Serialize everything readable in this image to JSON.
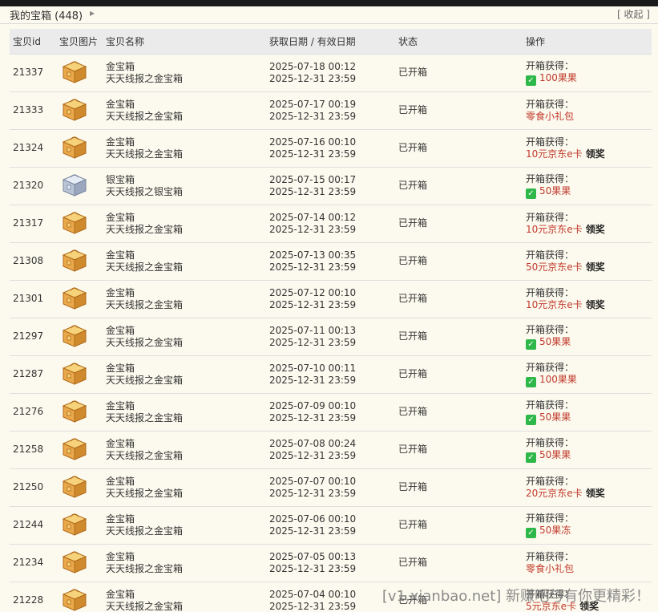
{
  "header": {
    "title": "我的宝箱 (448)",
    "collapse_label": "[ 收起 ]"
  },
  "table": {
    "columns": [
      "宝贝id",
      "宝贝图片",
      "宝贝名称",
      "获取日期 / 有效日期",
      "状态",
      "操作"
    ],
    "rows": [
      {
        "id": "21337",
        "icon": "gold-chest-icon",
        "type": "金宝箱",
        "desc": "天天线报之金宝箱",
        "obtained": "2025-07-18 00:12",
        "expires": "2025-12-31 23:59",
        "status": "已开箱",
        "prize_label": "开箱获得：",
        "check": true,
        "prize": "100果果",
        "claim": ""
      },
      {
        "id": "21333",
        "icon": "gold-chest-icon",
        "type": "金宝箱",
        "desc": "天天线报之金宝箱",
        "obtained": "2025-07-17 00:19",
        "expires": "2025-12-31 23:59",
        "status": "已开箱",
        "prize_label": "开箱获得：",
        "check": false,
        "prize": "零食小礼包",
        "claim": ""
      },
      {
        "id": "21324",
        "icon": "gold-chest-icon",
        "type": "金宝箱",
        "desc": "天天线报之金宝箱",
        "obtained": "2025-07-16 00:10",
        "expires": "2025-12-31 23:59",
        "status": "已开箱",
        "prize_label": "开箱获得：",
        "check": false,
        "prize": "10元京东e卡",
        "claim": "领奖"
      },
      {
        "id": "21320",
        "icon": "silver-chest-icon",
        "type": "银宝箱",
        "desc": "天天线报之银宝箱",
        "obtained": "2025-07-15 00:17",
        "expires": "2025-12-31 23:59",
        "status": "已开箱",
        "prize_label": "开箱获得：",
        "check": true,
        "prize": "50果果",
        "claim": ""
      },
      {
        "id": "21317",
        "icon": "gold-chest-icon",
        "type": "金宝箱",
        "desc": "天天线报之金宝箱",
        "obtained": "2025-07-14 00:12",
        "expires": "2025-12-31 23:59",
        "status": "已开箱",
        "prize_label": "开箱获得：",
        "check": false,
        "prize": "10元京东e卡",
        "claim": "领奖"
      },
      {
        "id": "21308",
        "icon": "gold-chest-icon",
        "type": "金宝箱",
        "desc": "天天线报之金宝箱",
        "obtained": "2025-07-13 00:35",
        "expires": "2025-12-31 23:59",
        "status": "已开箱",
        "prize_label": "开箱获得：",
        "check": false,
        "prize": "50元京东e卡",
        "claim": "领奖"
      },
      {
        "id": "21301",
        "icon": "gold-chest-icon",
        "type": "金宝箱",
        "desc": "天天线报之金宝箱",
        "obtained": "2025-07-12 00:10",
        "expires": "2025-12-31 23:59",
        "status": "已开箱",
        "prize_label": "开箱获得：",
        "check": false,
        "prize": "10元京东e卡",
        "claim": "领奖"
      },
      {
        "id": "21297",
        "icon": "gold-chest-icon",
        "type": "金宝箱",
        "desc": "天天线报之金宝箱",
        "obtained": "2025-07-11 00:13",
        "expires": "2025-12-31 23:59",
        "status": "已开箱",
        "prize_label": "开箱获得：",
        "check": true,
        "prize": "50果果",
        "claim": ""
      },
      {
        "id": "21287",
        "icon": "gold-chest-icon",
        "type": "金宝箱",
        "desc": "天天线报之金宝箱",
        "obtained": "2025-07-10 00:11",
        "expires": "2025-12-31 23:59",
        "status": "已开箱",
        "prize_label": "开箱获得：",
        "check": true,
        "prize": "100果果",
        "claim": ""
      },
      {
        "id": "21276",
        "icon": "gold-chest-icon",
        "type": "金宝箱",
        "desc": "天天线报之金宝箱",
        "obtained": "2025-07-09 00:10",
        "expires": "2025-12-31 23:59",
        "status": "已开箱",
        "prize_label": "开箱获得：",
        "check": true,
        "prize": "50果果",
        "claim": ""
      },
      {
        "id": "21258",
        "icon": "gold-chest-icon",
        "type": "金宝箱",
        "desc": "天天线报之金宝箱",
        "obtained": "2025-07-08 00:24",
        "expires": "2025-12-31 23:59",
        "status": "已开箱",
        "prize_label": "开箱获得：",
        "check": true,
        "prize": "50果果",
        "claim": ""
      },
      {
        "id": "21250",
        "icon": "gold-chest-icon",
        "type": "金宝箱",
        "desc": "天天线报之金宝箱",
        "obtained": "2025-07-07 00:10",
        "expires": "2025-12-31 23:59",
        "status": "已开箱",
        "prize_label": "开箱获得：",
        "check": false,
        "prize": "20元京东e卡",
        "claim": "领奖"
      },
      {
        "id": "21244",
        "icon": "gold-chest-icon",
        "type": "金宝箱",
        "desc": "天天线报之金宝箱",
        "obtained": "2025-07-06 00:10",
        "expires": "2025-12-31 23:59",
        "status": "已开箱",
        "prize_label": "开箱获得：",
        "check": true,
        "prize": "50果冻",
        "claim": ""
      },
      {
        "id": "21234",
        "icon": "gold-chest-icon",
        "type": "金宝箱",
        "desc": "天天线报之金宝箱",
        "obtained": "2025-07-05 00:13",
        "expires": "2025-12-31 23:59",
        "status": "已开箱",
        "prize_label": "开箱获得：",
        "check": false,
        "prize": "零食小礼包",
        "claim": ""
      },
      {
        "id": "21228",
        "icon": "gold-chest-icon",
        "type": "金宝箱",
        "desc": "天天线报之金宝箱",
        "obtained": "2025-07-04 00:10",
        "expires": "2025-12-31 23:59",
        "status": "已开箱",
        "prize_label": "开箱获得：",
        "check": false,
        "prize": "5元京东e卡",
        "claim": "领奖"
      }
    ]
  },
  "watermark": "[v1.xianbao.net] 新赚吧与有你更精彩！",
  "colors": {
    "background": "#fcfaee",
    "header_row": "#ebebeb",
    "prize": "#c0392b",
    "check": "#2eb84a",
    "gold": "#f0c060",
    "silver": "#c8d0e0"
  }
}
